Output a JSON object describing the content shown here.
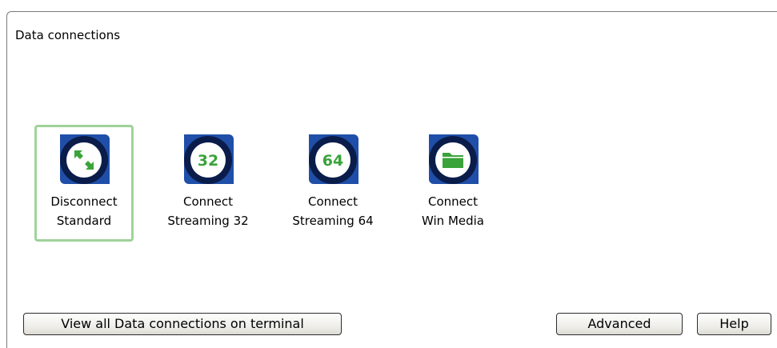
{
  "panel": {
    "title": "Data connections"
  },
  "tiles": [
    {
      "line1": "Disconnect",
      "line2": "Standard",
      "icon": "expand-arrows-icon",
      "selected": true
    },
    {
      "line1": "Connect",
      "line2": "Streaming 32",
      "icon": "streaming-32-icon",
      "glyph": "32",
      "selected": false
    },
    {
      "line1": "Connect",
      "line2": "Streaming 64",
      "icon": "streaming-64-icon",
      "glyph": "64",
      "selected": false
    },
    {
      "line1": "Connect",
      "line2": "Win Media",
      "icon": "folder-icon",
      "selected": false
    }
  ],
  "buttons": {
    "view_all": "View all Data connections on terminal",
    "advanced": "Advanced",
    "help": "Help"
  },
  "colors": {
    "icon_ring": "#0a1c4a",
    "icon_fill": "#ffffff",
    "icon_accent": "#3aa33a",
    "icon_backing": "#1f4fa8",
    "selection_border": "#9fd39a"
  }
}
